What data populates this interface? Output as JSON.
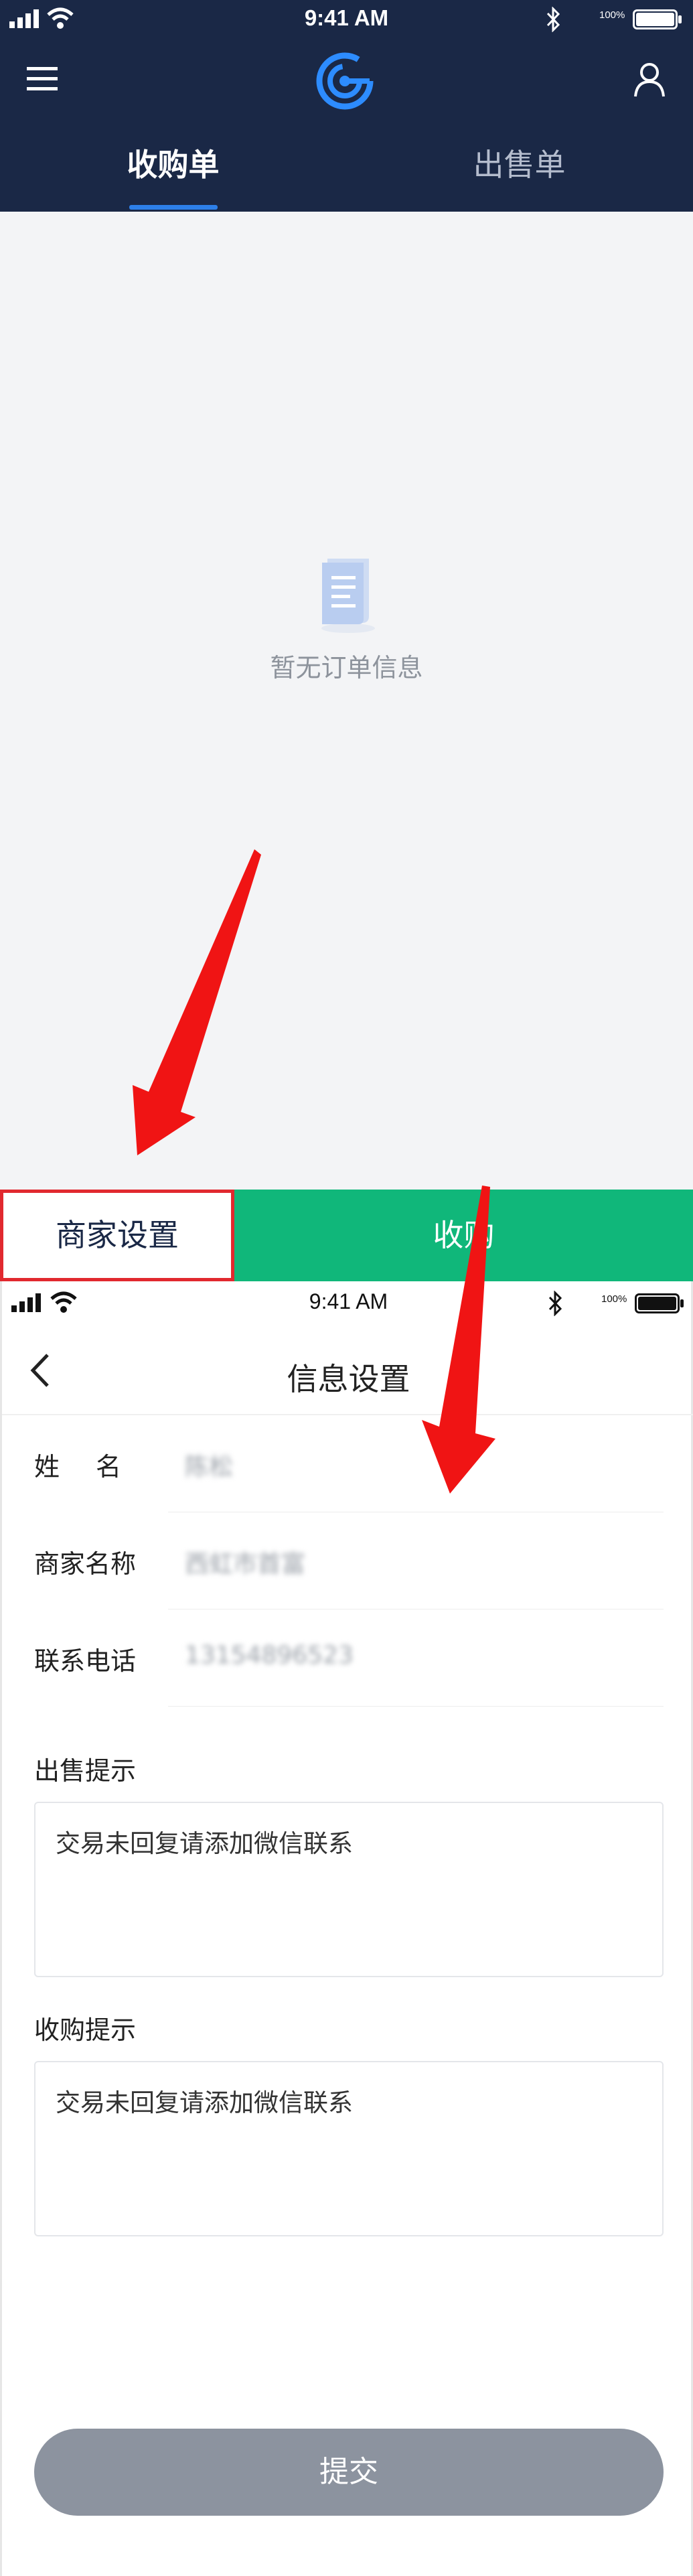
{
  "status_bar": {
    "time": "9:41 AM",
    "battery_percent": "100%",
    "battery_level": 1.0
  },
  "screen1": {
    "tabs": [
      {
        "label": "收购单",
        "active": true
      },
      {
        "label": "出售单",
        "active": false
      }
    ],
    "empty_message": "暂无订单信息",
    "merchant_button_label": "商家设置",
    "buy_button_label": "收购",
    "icons": {
      "menu": "menu-icon",
      "logo": "logo-icon",
      "user": "user-icon",
      "empty": "document-icon"
    },
    "colors": {
      "header_bg": "#1a2846",
      "tab_indicator": "#2d7fe8",
      "buy_button": "#10b77a",
      "highlight_border": "#e1292f"
    }
  },
  "screen2": {
    "title": "信息设置",
    "fields": [
      {
        "label": "姓名",
        "value": "陈松"
      },
      {
        "label": "商家名称",
        "value": "西虹市首富"
      },
      {
        "label": "联系电话",
        "value": "13154896523"
      }
    ],
    "sell_tip": {
      "label": "出售提示",
      "value": "交易未回复请添加微信联系"
    },
    "buy_tip": {
      "label": "收购提示",
      "value": "交易未回复请添加微信联系"
    },
    "submit_label": "提交",
    "icons": {
      "back": "chevron-left-icon"
    },
    "colors": {
      "submit_button": "#8c939f"
    }
  },
  "annotations": {
    "arrow_color": "#f01414"
  }
}
